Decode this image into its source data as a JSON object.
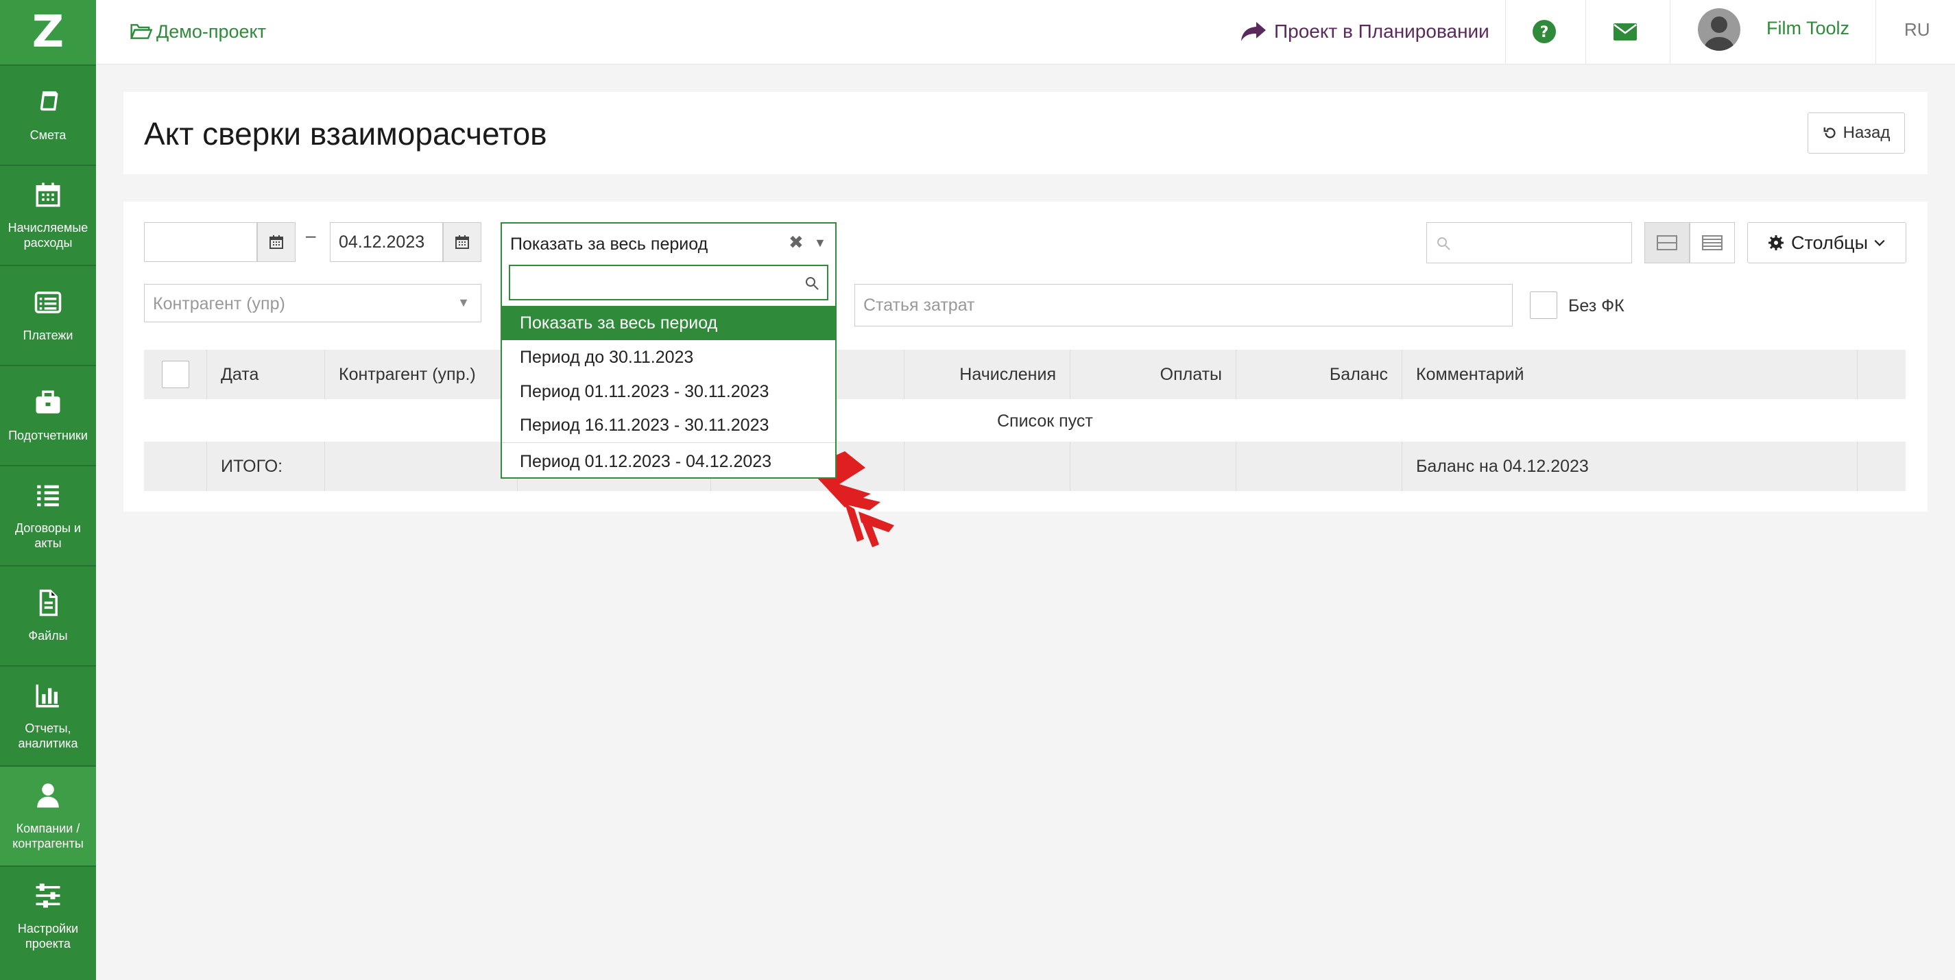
{
  "sidebar": {
    "logo": "Z",
    "items": [
      {
        "label": "Смета",
        "icon": "book-icon"
      },
      {
        "label": "Начисляемые расходы",
        "icon": "calendar-icon"
      },
      {
        "label": "Платежи",
        "icon": "list-card-icon"
      },
      {
        "label": "Подотчетники",
        "icon": "briefcase-icon"
      },
      {
        "label": "Договоры и акты",
        "icon": "list-icon"
      },
      {
        "label": "Файлы",
        "icon": "file-icon"
      },
      {
        "label": "Отчеты, аналитика",
        "icon": "bar-chart-icon"
      },
      {
        "label": "Компании / контрагенты",
        "icon": "user-icon"
      },
      {
        "label": "Настройки проекта",
        "icon": "sliders-icon"
      }
    ]
  },
  "topbar": {
    "project": "Демо-проект",
    "status": "Проект в Планировании",
    "user": "Film Toolz",
    "lang": "RU"
  },
  "page": {
    "title": "Акт сверки взаиморасчетов",
    "back": "Назад"
  },
  "filters": {
    "date_from": "",
    "dash": "–",
    "date_to": "04.12.2023",
    "period_value": "Показать за весь период",
    "clear_symbol": "✖",
    "caret_symbol": "▼",
    "contractor_placeholder": "Контрагент (упр)",
    "expense_placeholder": "Статья затрат",
    "without_fk": "Без ФК",
    "search_value": "",
    "columns_button": "Столбцы"
  },
  "dropdown": {
    "search_value": "",
    "options": [
      "Показать за весь период",
      "Период до 30.11.2023",
      "Период 01.11.2023 - 30.11.2023",
      "Период 16.11.2023 - 30.11.2023",
      "Период 01.12.2023 - 04.12.2023"
    ],
    "selected_index": 0
  },
  "table": {
    "columns": [
      "Дата",
      "Контрагент (упр.)",
      "",
      "",
      "Начисления",
      "Оплаты",
      "Баланс",
      "Комментарий"
    ],
    "empty_text": "Список пуст",
    "footer_label": "ИТОГО:",
    "footer_balance": "Баланс на 04.12.2023"
  },
  "colors": {
    "brand_green": "#2f8a3a",
    "status_purple": "#5a2a5c",
    "pointer_red": "#e02020"
  }
}
